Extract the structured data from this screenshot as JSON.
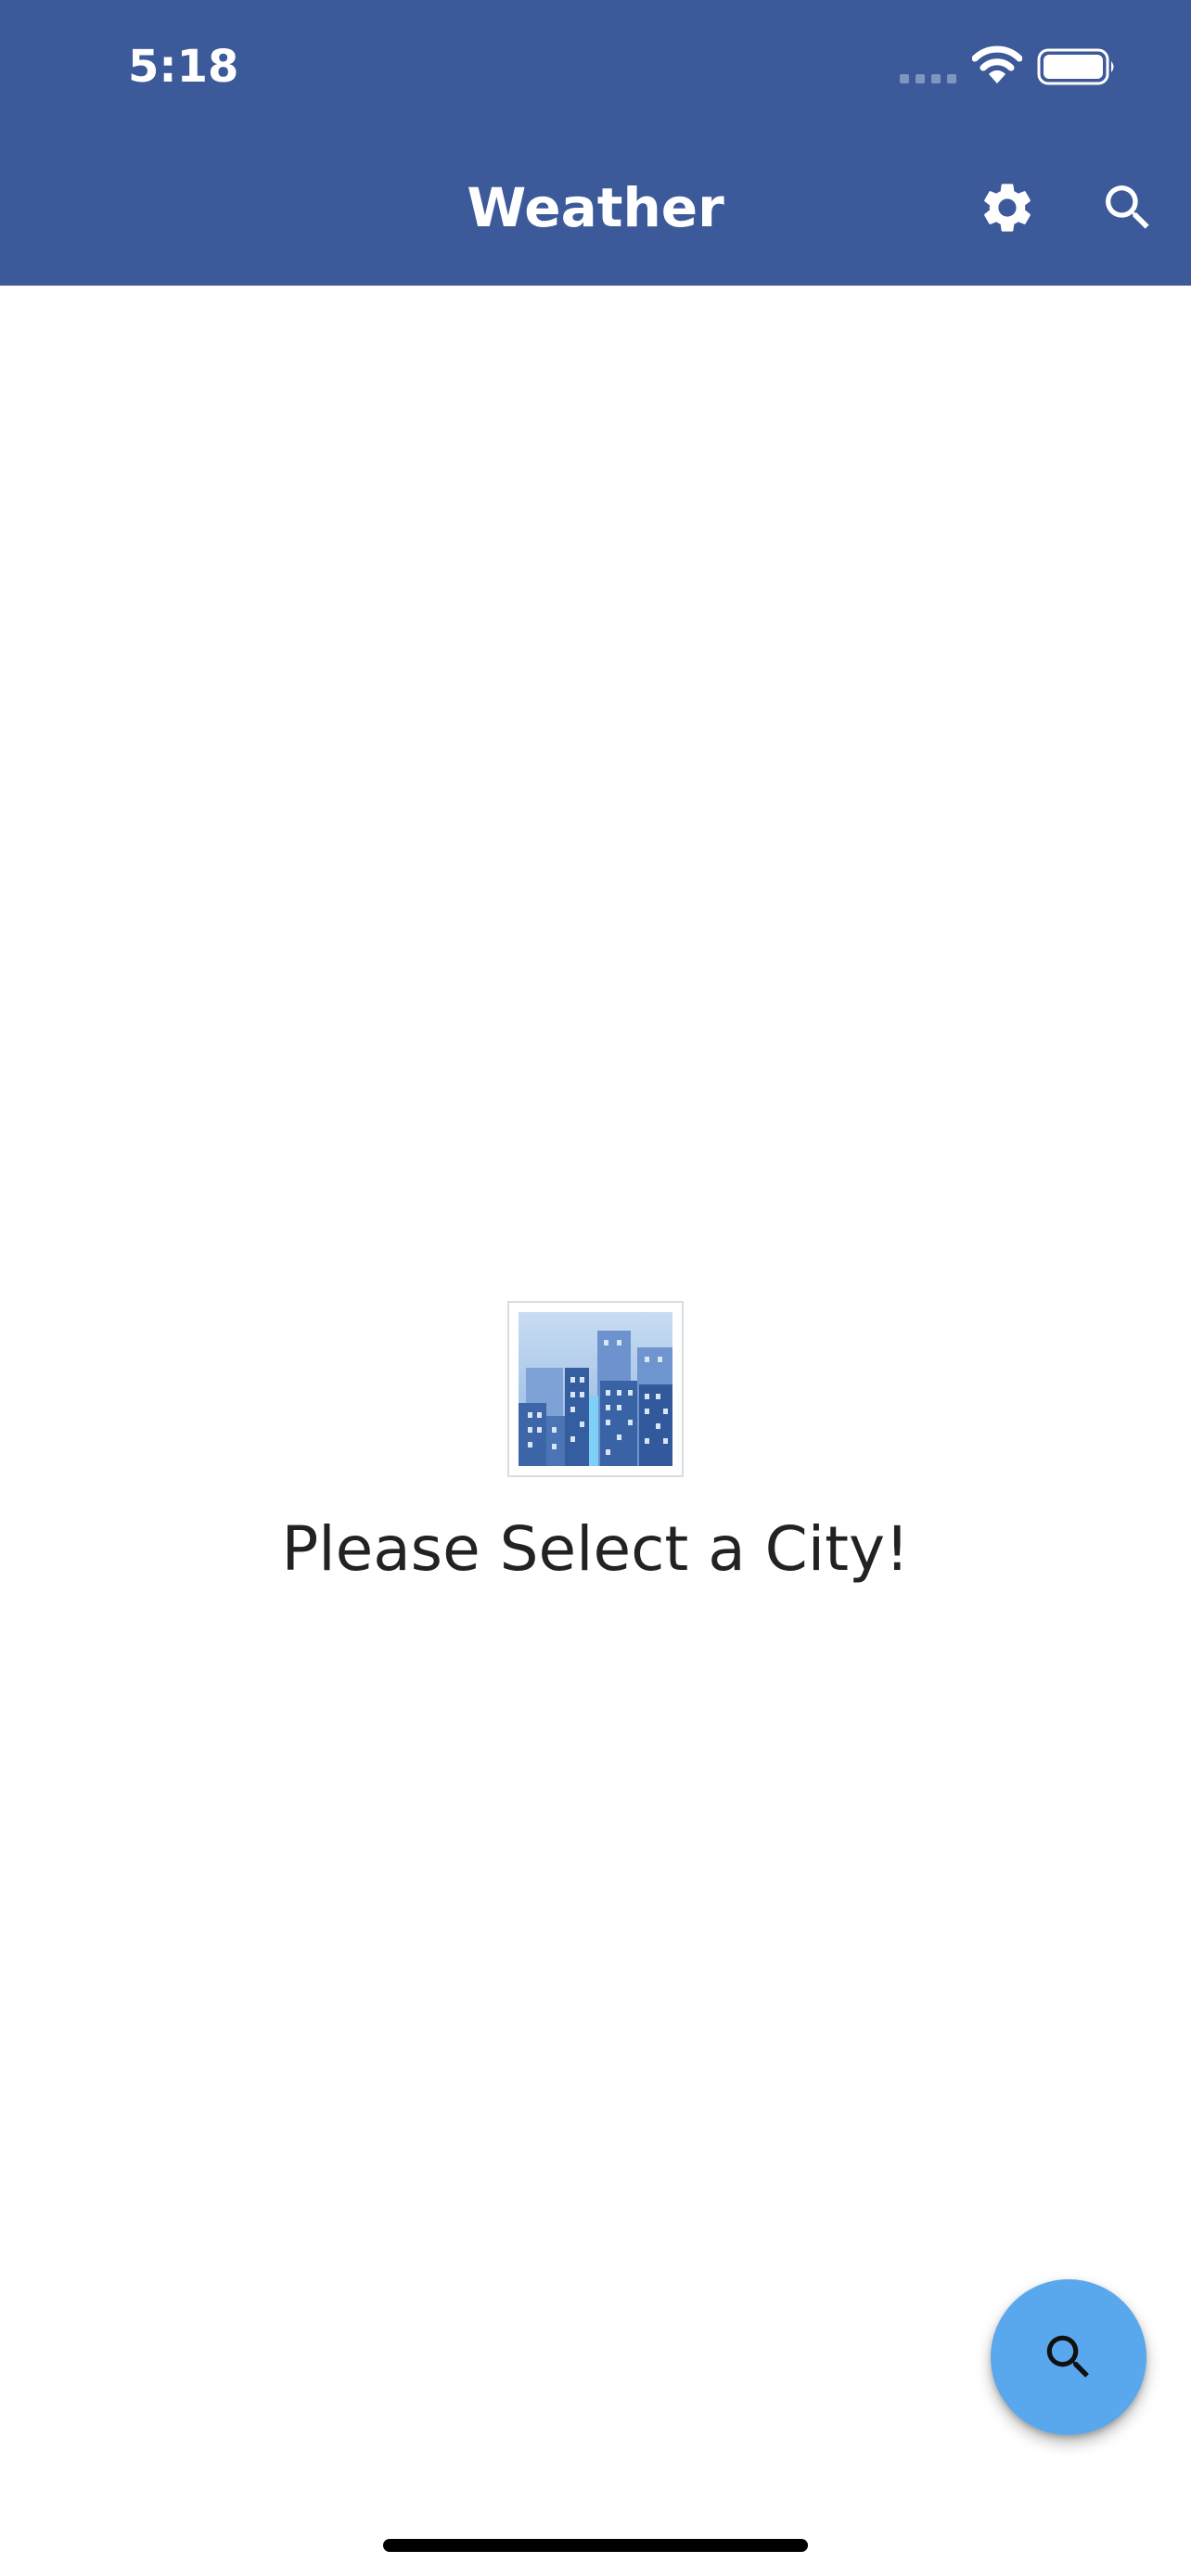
{
  "status_bar": {
    "time": "5:18",
    "icons": [
      "cellular-signal-icon",
      "wifi-icon",
      "battery-icon"
    ]
  },
  "app_bar": {
    "title": "Weather",
    "background_color": "#3c5a9a",
    "actions": [
      {
        "name": "settings",
        "icon": "gear-icon"
      },
      {
        "name": "search",
        "icon": "search-icon"
      }
    ]
  },
  "empty_state": {
    "image": "cityscape-icon",
    "message": "Please Select a City!"
  },
  "fab": {
    "icon": "search-icon",
    "color": "#59a8ee"
  }
}
